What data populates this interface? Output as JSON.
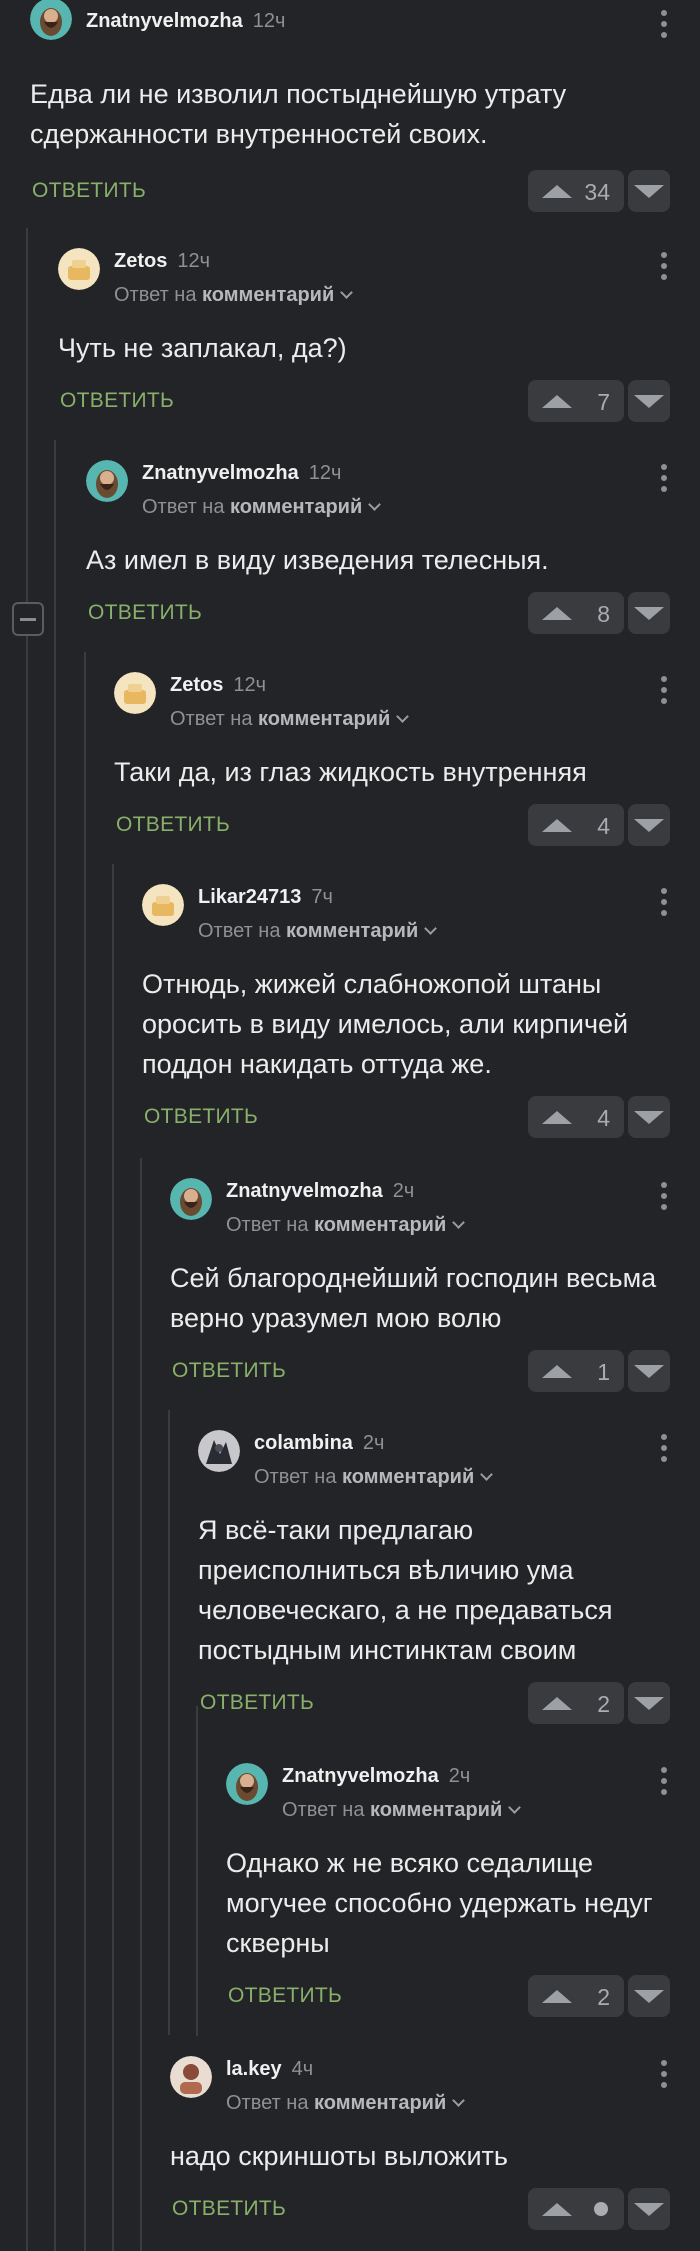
{
  "reply_label": "ОТВЕТИТЬ",
  "reply_to_prefix": "Ответ на",
  "reply_to_target": "комментарий",
  "comments": [
    {
      "author": "Znatnyvelmozha",
      "time": "12ч",
      "text": "Едва ли не изволил постыднейшую утрату сдержанности внутренностей своих.",
      "rating": "34"
    },
    {
      "author": "Zetos",
      "time": "12ч",
      "text": "Чуть не заплакал, да?)",
      "rating": "7"
    },
    {
      "author": "Znatnyvelmozha",
      "time": "12ч",
      "text": "Аз имел в виду изведения телесныя.",
      "rating": "8"
    },
    {
      "author": "Zetos",
      "time": "12ч",
      "text": "Таки да, из глаз жидкость внутренняя",
      "rating": "4"
    },
    {
      "author": "Likar24713",
      "time": "7ч",
      "text": "Отнюдь, жижей слабножопой штаны оросить в виду имелось, али кирпичей поддон накидать оттуда же.",
      "rating": "4"
    },
    {
      "author": "Znatnyvelmozha",
      "time": "2ч",
      "text": "Сей благороднейший господин весьма верно уразумел мою волю",
      "rating": "1"
    },
    {
      "author": "colambina",
      "time": "2ч",
      "text": "Я всё-таки предлагаю преисполниться вѣличию ума человеческаго, а не предаваться постыдным инстинктам своим",
      "rating": "2"
    },
    {
      "author": "Znatnyvelmozha",
      "time": "2ч",
      "text": "Однако ж не всяко седалище могучее способно удержать недуг скверны",
      "rating": "2"
    },
    {
      "author": "la.key",
      "time": "4ч",
      "text": "надо скриншоты выложить",
      "rating": ""
    }
  ],
  "colors": {
    "background": "#232427",
    "reply_accent": "#88b06a",
    "vote_bg": "#3a3b3e"
  },
  "icons": [
    "avatar-icon",
    "kebab-menu-icon",
    "chevron-down-icon",
    "vote-up-icon",
    "vote-down-icon",
    "collapse-thread-icon"
  ]
}
